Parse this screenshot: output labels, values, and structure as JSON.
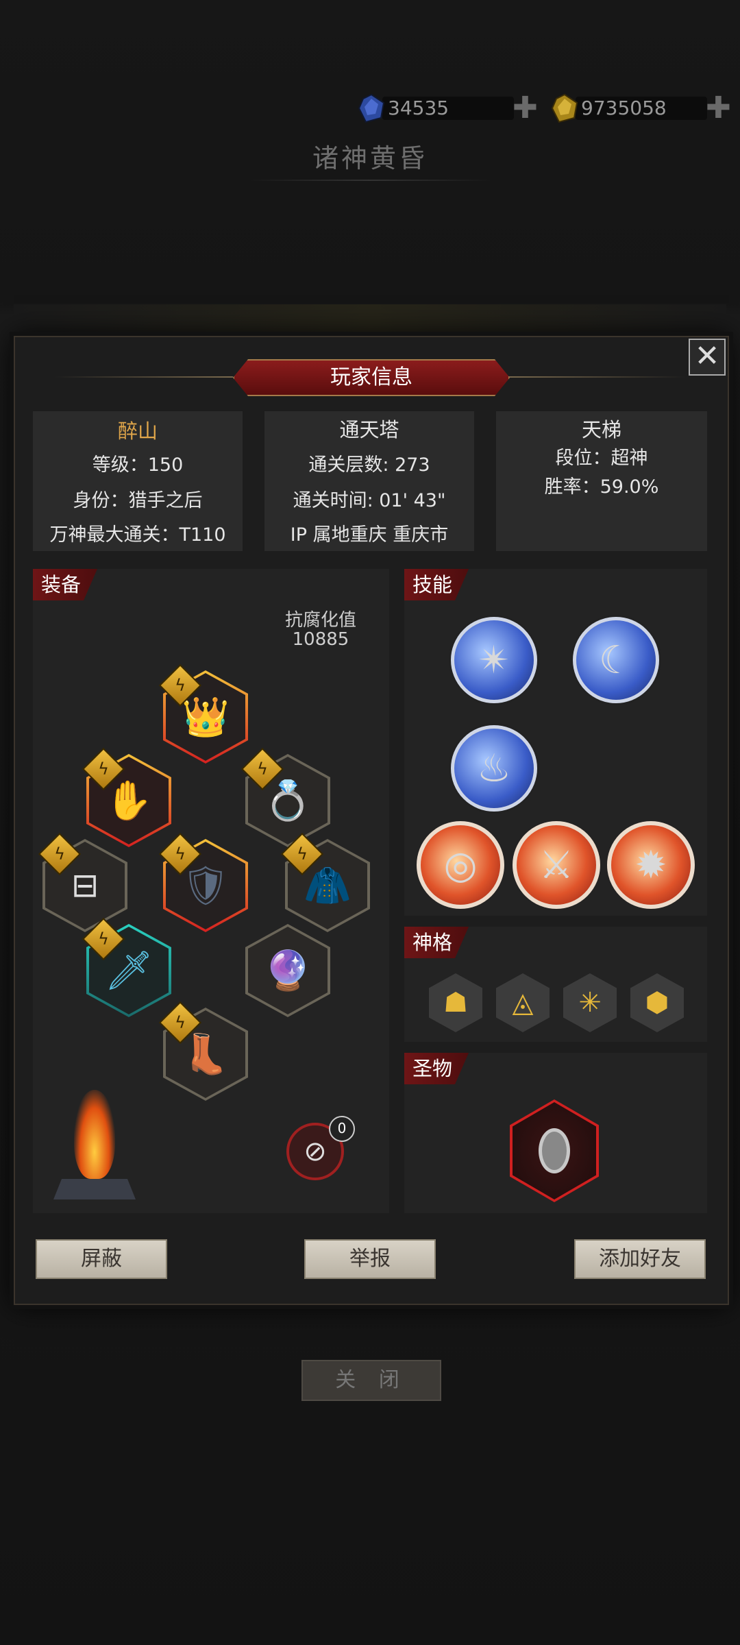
{
  "resources": [
    {
      "icon": "blue-gem-icon",
      "value": "34535",
      "color": "#3a5cb8"
    },
    {
      "icon": "gold-gem-icon",
      "value": "9735058",
      "color": "#c9a227"
    }
  ],
  "background_title": "诸神黄昏",
  "dialog": {
    "title": "玩家信息",
    "close_glyph": "✕"
  },
  "player": {
    "name": "醉山",
    "level": "等级：150",
    "identity": "身份：猎手之后",
    "max_clear": "万神最大通关：T110"
  },
  "tower": {
    "title": "通天塔",
    "floors": "通关层数: 273",
    "time": "通关时间: 01' 43\"",
    "ip": "IP 属地重庆 重庆市"
  },
  "ladder": {
    "title": "天梯",
    "rank": "段位：超神",
    "winrate": "胜率：59.0%"
  },
  "equipment": {
    "tag": "装备",
    "corruption_label": "抗腐化值",
    "corruption_value": "10885",
    "empty_count": "0"
  },
  "skills": {
    "tag": "技能"
  },
  "divinity": {
    "tag": "神格"
  },
  "relic": {
    "tag": "圣物"
  },
  "buttons": {
    "block": "屏蔽",
    "report": "举报",
    "add_friend": "添加好友"
  },
  "bottom_close": "关 闭",
  "colors": {
    "accent_red": "#6e1516",
    "gold_name": "#e0a64a",
    "badge_gold": "#f0c040"
  }
}
